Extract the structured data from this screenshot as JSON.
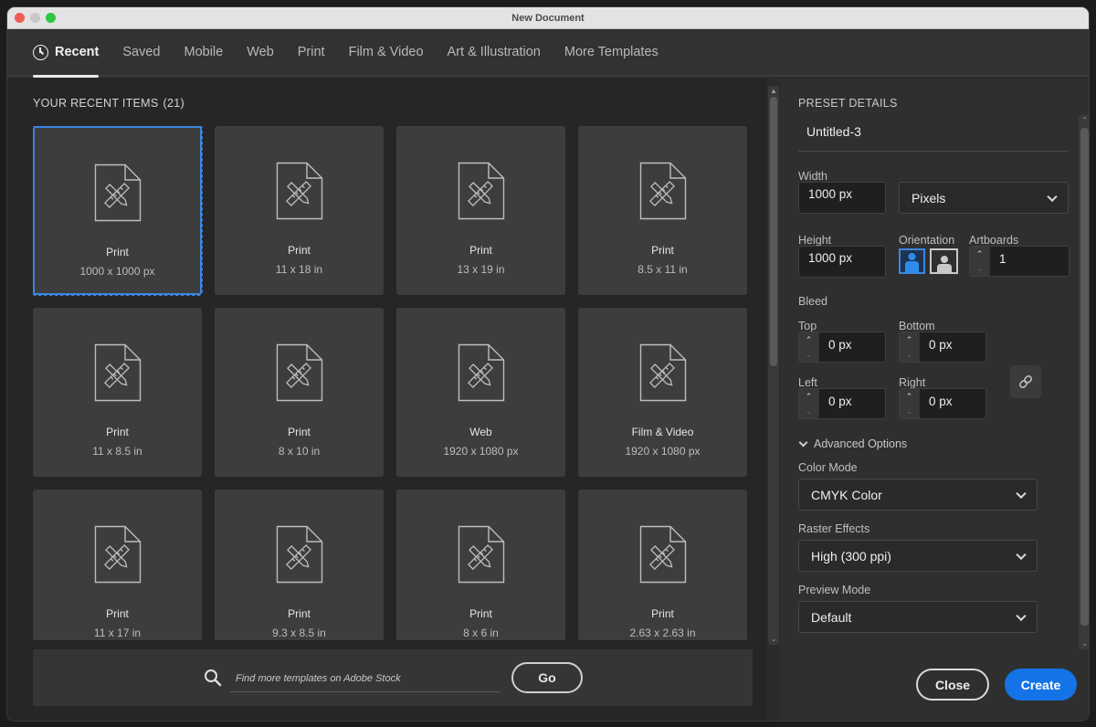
{
  "window": {
    "title": "New Document"
  },
  "tabs": [
    {
      "label": "Recent",
      "active": true,
      "icon": "clock-icon"
    },
    {
      "label": "Saved"
    },
    {
      "label": "Mobile"
    },
    {
      "label": "Web"
    },
    {
      "label": "Print"
    },
    {
      "label": "Film & Video"
    },
    {
      "label": "Art & Illustration"
    },
    {
      "label": "More Templates"
    }
  ],
  "recent": {
    "title": "YOUR RECENT ITEMS",
    "count": "(21)",
    "items": [
      {
        "name": "Print",
        "size": "1000 x 1000 px",
        "selected": true
      },
      {
        "name": "Print",
        "size": "11 x 18 in"
      },
      {
        "name": "Print",
        "size": "13 x 19 in"
      },
      {
        "name": "Print",
        "size": "8.5 x 11 in"
      },
      {
        "name": "Print",
        "size": "11 x 8.5 in"
      },
      {
        "name": "Print",
        "size": "8 x 10 in"
      },
      {
        "name": "Web",
        "size": "1920 x 1080 px"
      },
      {
        "name": "Film & Video",
        "size": "1920 x 1080 px"
      },
      {
        "name": "Print",
        "size": "11 x 17 in"
      },
      {
        "name": "Print",
        "size": "9.3 x 8.5 in"
      },
      {
        "name": "Print",
        "size": "8 x 6 in"
      },
      {
        "name": "Print",
        "size": "2.63 x 2.63 in"
      }
    ]
  },
  "stock": {
    "placeholder": "Find more templates on Adobe Stock",
    "go_label": "Go"
  },
  "preset": {
    "title": "PRESET DETAILS",
    "name": "Untitled-3",
    "width_label": "Width",
    "width_value": "1000 px",
    "units_value": "Pixels",
    "height_label": "Height",
    "height_value": "1000 px",
    "orientation_label": "Orientation",
    "orientation_value": "portrait",
    "artboards_label": "Artboards",
    "artboards_value": "1",
    "bleed_label": "Bleed",
    "bleed": {
      "top_label": "Top",
      "top_value": "0 px",
      "bottom_label": "Bottom",
      "bottom_value": "0 px",
      "left_label": "Left",
      "left_value": "0 px",
      "right_label": "Right",
      "right_value": "0 px"
    },
    "advanced_label": "Advanced Options",
    "color_mode_label": "Color Mode",
    "color_mode_value": "CMYK Color",
    "raster_label": "Raster Effects",
    "raster_value": "High (300 ppi)",
    "preview_label": "Preview Mode",
    "preview_value": "Default"
  },
  "actions": {
    "close_label": "Close",
    "create_label": "Create"
  },
  "colors": {
    "accent": "#1473e6",
    "selection": "#3d86e0"
  }
}
